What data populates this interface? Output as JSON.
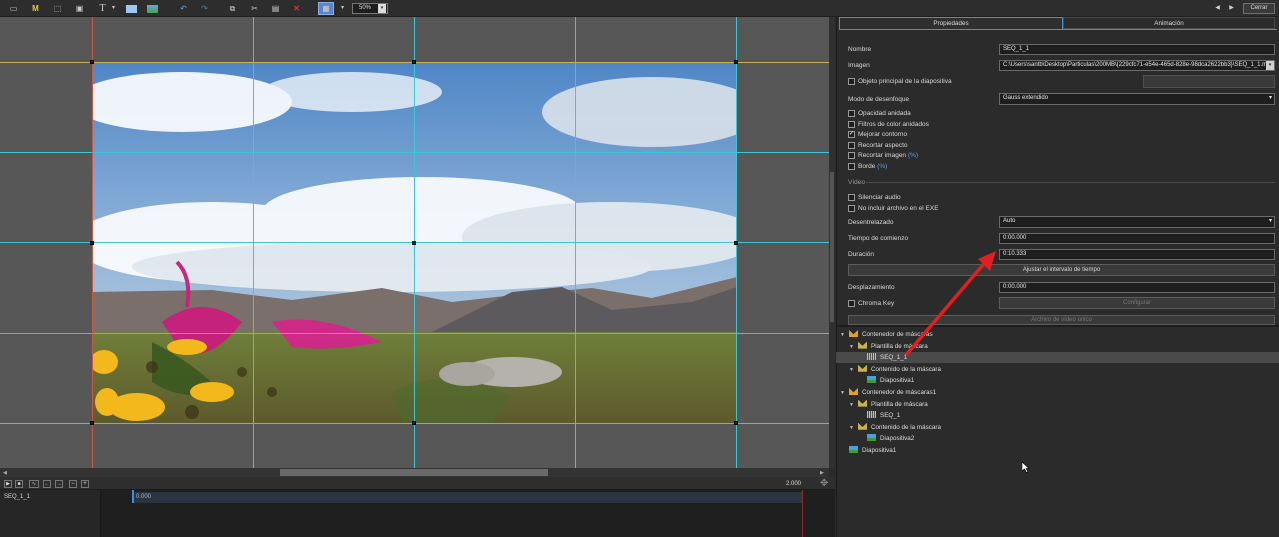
{
  "toolbar": {
    "zoom_value": "50%",
    "text_tool_glyph": "T",
    "m_tool_glyph": "M",
    "close_label": "Cerrar"
  },
  "tabs": {
    "properties": "Propiedades",
    "animation": "Animación"
  },
  "properties": {
    "name_label": "Nombre",
    "name_value": "SEQ_1_1",
    "image_label": "Imagen",
    "image_value": "C:\\Users\\santb\\Desktop\\Particulas\\200MB\\{229cfc71-e54e-465d-828e-98dca2622bb3}\\SEQ_1_1.mp",
    "main_object_label": "Objeto principal de la diapositiva",
    "blur_mode_label": "Modo de desenfoque",
    "blur_mode_value": "Gauss extendido",
    "nested_opacity": "Opacidad anidada",
    "nested_color_filters": "Filtros de color anidados",
    "improve_contour": "Mejorar contorno",
    "crop_aspect": "Recortar aspecto",
    "crop_image": "Recortar imagen",
    "crop_image_pct": "(%)",
    "border": "Borde",
    "border_pct": "(%)",
    "video_section": "Vídeo",
    "mute_audio": "Silenciar audio",
    "exclude_exe": "No incluir archivo en el EXE",
    "deinterlace_label": "Desentrelazado",
    "deinterlace_value": "Auto",
    "start_time_label": "Tiempo de comienzo",
    "start_time_value": "0:00.000",
    "duration_label": "Duración",
    "duration_value": "0:10.333",
    "adjust_interval_button": "Ajustar el intervalo de tiempo",
    "offset_label": "Desplazamiento",
    "offset_value": "0:00.000",
    "chroma_key": "Chroma Key",
    "configure_button": "Configurar",
    "single_video_file": "Archivo de vídeo único"
  },
  "tree": [
    {
      "label": "Contenedor de máscaras",
      "icon": "mask-container-icon",
      "indent": 0,
      "expander": "v"
    },
    {
      "label": "Plantilla de máscara",
      "icon": "mask-template-icon",
      "indent": 1,
      "expander": "v"
    },
    {
      "label": "SEQ_1_1",
      "icon": "video-icon",
      "indent": 2,
      "expander": "",
      "selected": true
    },
    {
      "label": "Contenido de la máscara",
      "icon": "mask-content-icon",
      "indent": 1,
      "expander": "v"
    },
    {
      "label": "Diapositiva1",
      "icon": "image-icon",
      "indent": 2,
      "expander": ""
    },
    {
      "label": "Contenedor de máscaras1",
      "icon": "mask-container-icon",
      "indent": 0,
      "expander": "v"
    },
    {
      "label": "Plantilla de máscara",
      "icon": "mask-template-icon",
      "indent": 1,
      "expander": "v"
    },
    {
      "label": "SEQ_1",
      "icon": "video-icon",
      "indent": 2,
      "expander": ""
    },
    {
      "label": "Contenido de la máscara",
      "icon": "mask-content-icon",
      "indent": 1,
      "expander": "v"
    },
    {
      "label": "Diapositiva2",
      "icon": "image-icon",
      "indent": 2,
      "expander": ""
    },
    {
      "label": "Diapositiva1",
      "icon": "image-icon",
      "indent": 0,
      "expander": ""
    }
  ],
  "timeline": {
    "track_name": "SEQ_1_1",
    "track_start": "0.000",
    "total_time": "2.000"
  },
  "colors": {
    "accent": "#3cc6d6",
    "annotation_arrow": "#e02020",
    "selection": "#4a4a4a"
  }
}
